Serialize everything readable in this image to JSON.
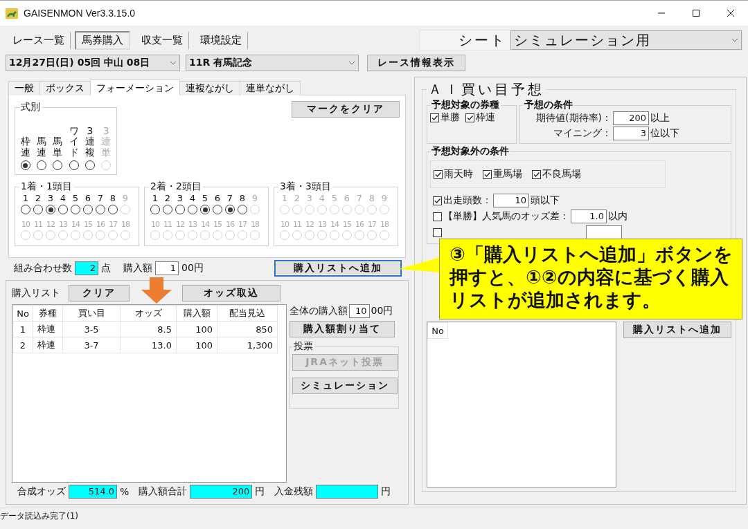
{
  "window": {
    "title": "GAISENMON Ver3.3.15.0"
  },
  "menu": [
    {
      "label": "レース一覧",
      "selected": false
    },
    {
      "label": "馬券購入",
      "selected": true
    },
    {
      "label": "収支一覧",
      "selected": false
    },
    {
      "label": "環境設定",
      "selected": false
    }
  ],
  "sheet": {
    "label": "シート",
    "value": "シミュレーション用"
  },
  "race_selector": {
    "date": "12月27日(日) 05回 中山 08日",
    "race": "11R 有馬記念",
    "info_button": "レース情報表示"
  },
  "bet_tabs": [
    {
      "label": "一般",
      "selected": false
    },
    {
      "label": "ボックス",
      "selected": false
    },
    {
      "label": "フォーメーション",
      "selected": true
    },
    {
      "label": "連複ながし",
      "selected": false
    },
    {
      "label": "連単ながし",
      "selected": false
    }
  ],
  "formation": {
    "clear_button": "マークをクリア",
    "bet_type": {
      "title": "式別",
      "options": [
        {
          "label": "枠連",
          "selected": true,
          "disabled": false
        },
        {
          "label": "馬連",
          "selected": false,
          "disabled": false
        },
        {
          "label": "馬単",
          "selected": false,
          "disabled": false
        },
        {
          "label": "ワイド",
          "selected": false,
          "disabled": false
        },
        {
          "label": "3連複",
          "selected": false,
          "disabled": false
        },
        {
          "label": "3連単",
          "selected": false,
          "disabled": true
        }
      ]
    },
    "positions": [
      {
        "title": "1着・1頭目",
        "numbers": [
          {
            "label": "1",
            "selected": false,
            "disabled": false
          },
          {
            "label": "2",
            "selected": false,
            "disabled": false
          },
          {
            "label": "3",
            "selected": true,
            "disabled": false
          },
          {
            "label": "4",
            "selected": false,
            "disabled": false
          },
          {
            "label": "5",
            "selected": false,
            "disabled": false
          },
          {
            "label": "6",
            "selected": false,
            "disabled": false
          },
          {
            "label": "7",
            "selected": false,
            "disabled": false
          },
          {
            "label": "8",
            "selected": false,
            "disabled": false
          },
          {
            "label": "9",
            "selected": false,
            "disabled": true
          },
          {
            "label": "10",
            "selected": false,
            "disabled": true
          },
          {
            "label": "11",
            "selected": false,
            "disabled": true
          },
          {
            "label": "12",
            "selected": false,
            "disabled": true
          },
          {
            "label": "13",
            "selected": false,
            "disabled": true
          },
          {
            "label": "14",
            "selected": false,
            "disabled": true
          },
          {
            "label": "15",
            "selected": false,
            "disabled": true
          },
          {
            "label": "16",
            "selected": false,
            "disabled": true
          },
          {
            "label": "17",
            "selected": false,
            "disabled": true
          },
          {
            "label": "18",
            "selected": false,
            "disabled": true
          }
        ]
      },
      {
        "title": "2着・2頭目",
        "numbers": [
          {
            "label": "1",
            "selected": false,
            "disabled": false
          },
          {
            "label": "2",
            "selected": false,
            "disabled": false
          },
          {
            "label": "3",
            "selected": false,
            "disabled": false
          },
          {
            "label": "4",
            "selected": false,
            "disabled": false
          },
          {
            "label": "5",
            "selected": true,
            "disabled": false
          },
          {
            "label": "6",
            "selected": false,
            "disabled": false
          },
          {
            "label": "7",
            "selected": true,
            "disabled": false
          },
          {
            "label": "8",
            "selected": false,
            "disabled": false
          },
          {
            "label": "9",
            "selected": false,
            "disabled": true
          },
          {
            "label": "10",
            "selected": false,
            "disabled": true
          },
          {
            "label": "11",
            "selected": false,
            "disabled": true
          },
          {
            "label": "12",
            "selected": false,
            "disabled": true
          },
          {
            "label": "13",
            "selected": false,
            "disabled": true
          },
          {
            "label": "14",
            "selected": false,
            "disabled": true
          },
          {
            "label": "15",
            "selected": false,
            "disabled": true
          },
          {
            "label": "16",
            "selected": false,
            "disabled": true
          },
          {
            "label": "17",
            "selected": false,
            "disabled": true
          },
          {
            "label": "18",
            "selected": false,
            "disabled": true
          }
        ]
      },
      {
        "title": "3着・3頭目",
        "numbers": [
          {
            "label": "1",
            "selected": false,
            "disabled": true
          },
          {
            "label": "2",
            "selected": false,
            "disabled": true
          },
          {
            "label": "3",
            "selected": false,
            "disabled": true
          },
          {
            "label": "4",
            "selected": false,
            "disabled": true
          },
          {
            "label": "5",
            "selected": false,
            "disabled": true
          },
          {
            "label": "6",
            "selected": false,
            "disabled": true
          },
          {
            "label": "7",
            "selected": false,
            "disabled": true
          },
          {
            "label": "8",
            "selected": false,
            "disabled": true
          },
          {
            "label": "9",
            "selected": false,
            "disabled": true
          },
          {
            "label": "10",
            "selected": false,
            "disabled": true
          },
          {
            "label": "11",
            "selected": false,
            "disabled": true
          },
          {
            "label": "12",
            "selected": false,
            "disabled": true
          },
          {
            "label": "13",
            "selected": false,
            "disabled": true
          },
          {
            "label": "14",
            "selected": false,
            "disabled": true
          },
          {
            "label": "15",
            "selected": false,
            "disabled": true
          },
          {
            "label": "16",
            "selected": false,
            "disabled": true
          },
          {
            "label": "17",
            "selected": false,
            "disabled": true
          },
          {
            "label": "18",
            "selected": false,
            "disabled": true
          }
        ]
      }
    ],
    "combinations": {
      "label": "組み合わせ数",
      "value": "2",
      "unit": "点"
    },
    "amount": {
      "label": "購入額",
      "value": "1",
      "unit": "00円"
    },
    "add_button": {
      "label": "購入リストへ追加",
      "focused": true
    }
  },
  "purchase_list": {
    "label": "購入リスト",
    "clear_button": "クリア",
    "odds_button": "オッズ取込",
    "columns": [
      "No",
      "券種",
      "買い目",
      "オッズ",
      "購入額",
      "配当見込"
    ],
    "rows": [
      [
        "1",
        "枠連",
        "3-5",
        "8.5",
        "100",
        "850"
      ],
      [
        "2",
        "枠連",
        "3-7",
        "13.0",
        "100",
        "1,300"
      ]
    ],
    "total_amount": {
      "label": "全体の購入額",
      "value": "10",
      "unit": "00円"
    },
    "allocate_button": "購入額割り当て",
    "vote": {
      "title": "投票",
      "buttons": [
        {
          "label": "JRAネット投票",
          "disabled": true
        },
        {
          "label": "シミュレーション",
          "disabled": false
        }
      ]
    },
    "summary": [
      {
        "label": "合成オッズ",
        "value": "514.0",
        "unit": "%"
      },
      {
        "label": "購入額合計",
        "value": "200",
        "unit": "円"
      },
      {
        "label": "入金残額",
        "unit": "円"
      }
    ]
  },
  "ai_prediction": {
    "title": "ＡＩ買い目予想",
    "bet_types": {
      "title": "予想対象の券種",
      "items": [
        {
          "label": "単勝",
          "checked": true
        },
        {
          "label": "枠連",
          "checked": true
        }
      ]
    },
    "conditions": {
      "title": "予想の条件",
      "rows": [
        {
          "label": "期待値(期待率)：",
          "value": "200",
          "unit": "以上"
        },
        {
          "label": "マイニング：",
          "value": "3",
          "unit": "位以下"
        }
      ]
    },
    "exclusions": {
      "title": "予想対象外の条件",
      "track": [
        {
          "label": "雨天時",
          "checked": true
        },
        {
          "label": "重馬場",
          "checked": true
        },
        {
          "label": "不良馬場",
          "checked": true
        }
      ],
      "rows": [
        {
          "label": "出走頭数：",
          "checked": true,
          "value": "10",
          "unit": "頭以下"
        },
        {
          "label": "【単勝】人気馬のオッズ差：",
          "checked": false,
          "value": "1.0",
          "unit": "以内"
        },
        {
          "checked": false
        }
      ]
    },
    "columns": [
      "No"
    ],
    "add_button": "購入リストへ追加"
  },
  "callout": {
    "text": "③「購入リストへ追加」ボタンを押すと、①②の内容に基づく購入リストが追加されます。"
  },
  "status_bar": "データ読込み完了(1)"
}
